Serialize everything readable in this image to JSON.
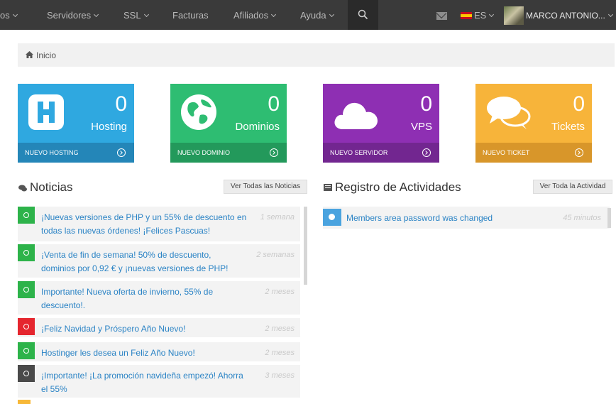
{
  "topnav": {
    "items": [
      {
        "label": "os"
      },
      {
        "label": "Servidores"
      },
      {
        "label": "SSL"
      },
      {
        "label": "Facturas"
      },
      {
        "label": "Afiliados"
      },
      {
        "label": "Ayuda"
      }
    ],
    "language": "ES",
    "user_name": "MARCO ANTONIO...",
    "icons": [
      "search-icon",
      "mail-icon",
      "flag-spain-icon",
      "avatar"
    ]
  },
  "breadcrumb": {
    "label": "Inicio",
    "icon": "home-icon"
  },
  "tiles": [
    {
      "count": "0",
      "label": "Hosting",
      "footer": "NUEVO HOSTING",
      "color": "#2fa8e0",
      "footer_color": "#2486b8",
      "icon": "hosting-h-icon"
    },
    {
      "count": "0",
      "label": "Dominios",
      "footer": "NUEVO DOMINIO",
      "color": "#2ebd72",
      "footer_color": "#23995b",
      "icon": "globe-icon"
    },
    {
      "count": "0",
      "label": "VPS",
      "footer": "NUEVO SERVIDOR",
      "color": "#8e2fb3",
      "footer_color": "#722690",
      "icon": "cloud-icon"
    },
    {
      "count": "0",
      "label": "Tickets",
      "footer": "NUEVO TICKET",
      "color": "#f7b43a",
      "footer_color": "#d8962a",
      "icon": "chat-bubbles-icon"
    }
  ],
  "news": {
    "title": "Noticias",
    "button": "Ver Todas las Noticias",
    "items": [
      {
        "text": "¡Nuevas versiones de PHP y un 55% de descuento en todas las nuevas órdenes! ¡Felices Pascuas!",
        "time": "1 semana",
        "color": "#2db34a"
      },
      {
        "text": "¡Venta de fin de semana! 50% de descuento, dominios por 0,92 € y ¡nuevas versiones de PHP!",
        "time": "2 semanas",
        "color": "#2db34a"
      },
      {
        "text": "Importante! Nueva oferta de invierno, 55% de descuento!.",
        "time": "2 meses",
        "color": "#2db34a"
      },
      {
        "text": "¡Feliz Navidad y Próspero Año Nuevo!",
        "time": "2 meses",
        "color": "#e5262e"
      },
      {
        "text": "Hostinger les desea un Feliz Año Nuevo!",
        "time": "2 meses",
        "color": "#2db34a"
      },
      {
        "text": "¡Importante! ¡La promoción navideña empezó! Ahorra el 55%",
        "time": "3 meses",
        "color": "#4a4a4a"
      }
    ]
  },
  "activity": {
    "title": "Registro de Actividades",
    "button": "Ver Toda la Actividad",
    "items": [
      {
        "text": "Members area password was changed",
        "time": "45 minutos"
      }
    ]
  }
}
